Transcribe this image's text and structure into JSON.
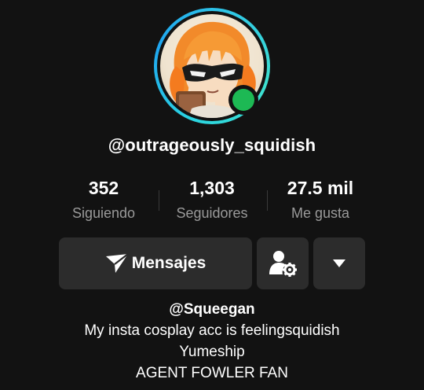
{
  "profile": {
    "username": "@outrageously_squidish",
    "online": true,
    "avatar_description": "Inkling girl with orange hair and black mask",
    "ring_color": "#2bd4e0",
    "online_color": "#1db954"
  },
  "stats": [
    {
      "value": "352",
      "label": "Siguiendo"
    },
    {
      "value": "1,303",
      "label": "Seguidores"
    },
    {
      "value": "27.5 mil",
      "label": "Me gusta"
    }
  ],
  "actions": {
    "messages_label": "Mensajes",
    "messages_icon": "send-icon",
    "friends_icon": "user-settings-icon",
    "more_icon": "caret-down-icon"
  },
  "bio": {
    "handle": "@Squeegan",
    "lines": [
      "My insta cosplay acc is feelingsquidish",
      "Yumeship",
      "AGENT FOWLER FAN"
    ]
  }
}
